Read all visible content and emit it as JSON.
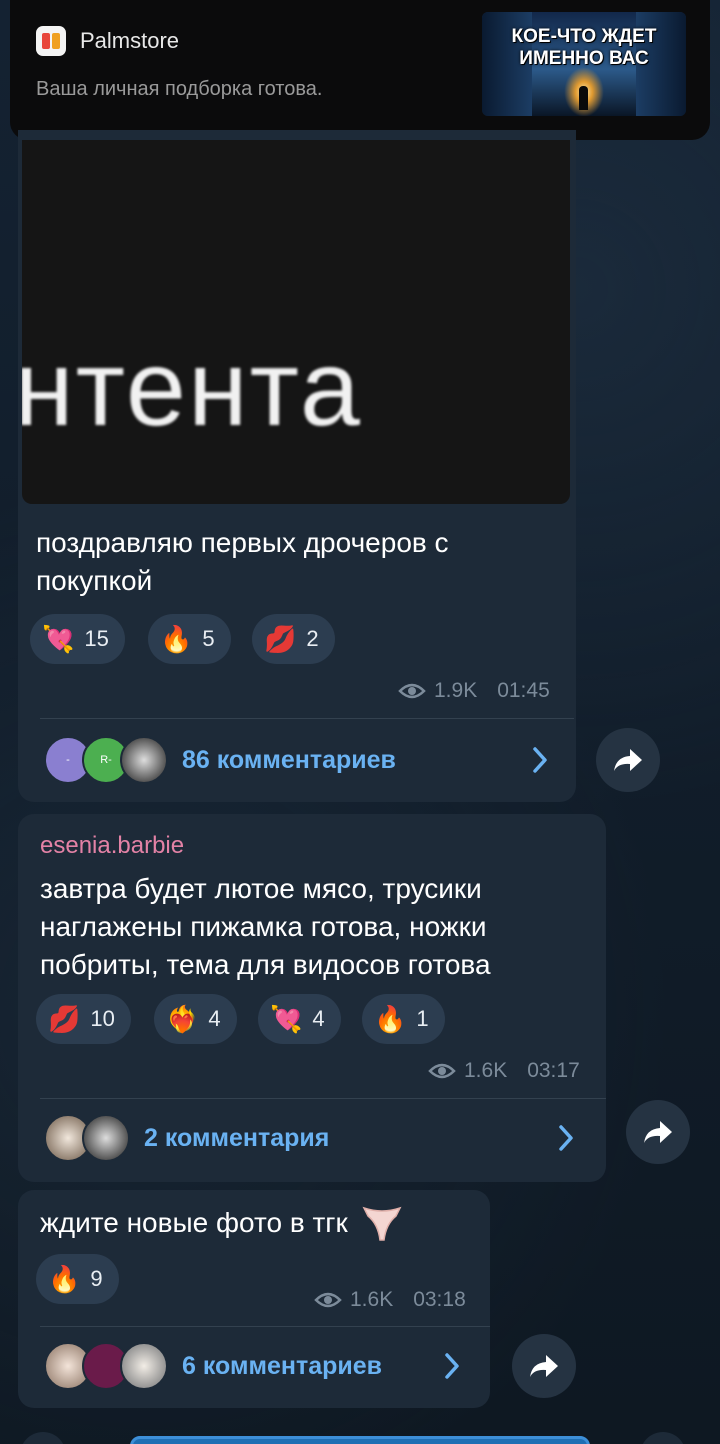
{
  "notification": {
    "app_name": "Palmstore",
    "text": "Ваша личная подборка готова.",
    "thumbnail_title": "КОЕ-ЧТО ЖДЕТ\nИМЕННО ВАС"
  },
  "messages": [
    {
      "media_text": "нтента",
      "text": "поздравляю первых дрочеров с покупкой",
      "reactions": [
        {
          "emoji": "💘",
          "count": "15"
        },
        {
          "emoji": "🔥",
          "count": "5"
        },
        {
          "emoji": "💋",
          "count": "2"
        }
      ],
      "views": "1.9K",
      "time": "01:45",
      "comments_label": "86 комментариев",
      "avatar_initials": [
        "-",
        "R-",
        ""
      ]
    },
    {
      "author": "esenia.barbie",
      "text": "завтра будет лютое мясо, трусики наглажены пижамка готова, ножки побриты, тема для видосов готова",
      "reactions": [
        {
          "emoji": "💋",
          "count": "10"
        },
        {
          "emoji": "❤️‍🔥",
          "count": "4"
        },
        {
          "emoji": "💘",
          "count": "4"
        },
        {
          "emoji": "🔥",
          "count": "1"
        }
      ],
      "views": "1.6K",
      "time": "03:17",
      "comments_label": "2 комментария"
    },
    {
      "text": "ждите новые фото в тгк",
      "reactions": [
        {
          "emoji": "🔥",
          "count": "9"
        }
      ],
      "views": "1.6K",
      "time": "03:18",
      "comments_label": "6 комментариев"
    }
  ],
  "colors": {
    "background": "#0f1a25",
    "bubble": "#1d2a38",
    "link_blue": "#6ab2f2",
    "author_pink": "#e382a6",
    "meta_gray": "#7c8b9a"
  },
  "icons": [
    "eye-icon",
    "chevron-right-icon",
    "forward-arrow-icon"
  ]
}
